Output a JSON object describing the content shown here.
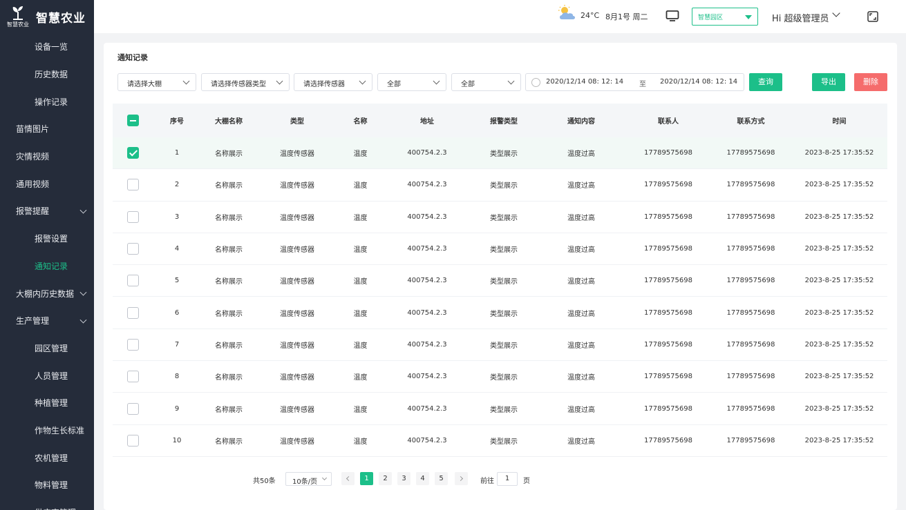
{
  "app": {
    "logo_small": "智慧农业",
    "title": "智慧农业"
  },
  "sidebar": {
    "items": [
      {
        "label": "设备一览",
        "level": "sub"
      },
      {
        "label": "历史数据",
        "level": "sub"
      },
      {
        "label": "操作记录",
        "level": "sub"
      },
      {
        "label": "苗情图片",
        "level": "top"
      },
      {
        "label": "灾情视频",
        "level": "top"
      },
      {
        "label": "通用视频",
        "level": "top"
      },
      {
        "label": "报警提醒",
        "level": "top",
        "expandable": true
      },
      {
        "label": "报警设置",
        "level": "sub"
      },
      {
        "label": "通知记录",
        "level": "sub",
        "active": true
      },
      {
        "label": "大棚内历史数据",
        "level": "top",
        "expandable": true
      },
      {
        "label": "生产管理",
        "level": "top",
        "expandable": true
      },
      {
        "label": "园区管理",
        "level": "sub"
      },
      {
        "label": "人员管理",
        "level": "sub"
      },
      {
        "label": "种植管理",
        "level": "sub"
      },
      {
        "label": "作物生长标准",
        "level": "sub"
      },
      {
        "label": "农机管理",
        "level": "sub"
      },
      {
        "label": "物料管理",
        "level": "sub"
      },
      {
        "label": "供应商管理",
        "level": "sub"
      }
    ]
  },
  "header": {
    "temperature": "24°C",
    "date": "8月1号 周二",
    "park_select": "智慧园区",
    "greeting": "Hi 超级管理员"
  },
  "page": {
    "title": "通知记录"
  },
  "filters": {
    "greenhouse": "请选择大棚",
    "sensor_type": "请选择传感器类型",
    "sensor": "请选择传感器",
    "status1": "全部",
    "status2": "全部",
    "date_start": "2020/12/14  08: 12: 14",
    "date_sep": "至",
    "date_end": "2020/12/14  08: 12: 14",
    "query_button": "查询",
    "export_button": "导出",
    "delete_button": "删除"
  },
  "table": {
    "headers": [
      "序号",
      "大棚名称",
      "类型",
      "名称",
      "地址",
      "报警类型",
      "通知内容",
      "联系人",
      "联系方式",
      "时间"
    ],
    "rows": [
      {
        "checked": true,
        "cells": [
          "1",
          "名称展示",
          "温度传感器",
          "温度",
          "400754.2.3",
          "类型展示",
          "温度过高",
          "17789575698",
          "17789575698",
          "2023-8-25  17:35:52"
        ]
      },
      {
        "checked": false,
        "cells": [
          "2",
          "名称展示",
          "温度传感器",
          "温度",
          "400754.2.3",
          "类型展示",
          "温度过高",
          "17789575698",
          "17789575698",
          "2023-8-25  17:35:52"
        ]
      },
      {
        "checked": false,
        "cells": [
          "3",
          "名称展示",
          "温度传感器",
          "温度",
          "400754.2.3",
          "类型展示",
          "温度过高",
          "17789575698",
          "17789575698",
          "2023-8-25  17:35:52"
        ]
      },
      {
        "checked": false,
        "cells": [
          "4",
          "名称展示",
          "温度传感器",
          "温度",
          "400754.2.3",
          "类型展示",
          "温度过高",
          "17789575698",
          "17789575698",
          "2023-8-25  17:35:52"
        ]
      },
      {
        "checked": false,
        "cells": [
          "5",
          "名称展示",
          "温度传感器",
          "温度",
          "400754.2.3",
          "类型展示",
          "温度过高",
          "17789575698",
          "17789575698",
          "2023-8-25  17:35:52"
        ]
      },
      {
        "checked": false,
        "cells": [
          "6",
          "名称展示",
          "温度传感器",
          "温度",
          "400754.2.3",
          "类型展示",
          "温度过高",
          "17789575698",
          "17789575698",
          "2023-8-25  17:35:52"
        ]
      },
      {
        "checked": false,
        "cells": [
          "7",
          "名称展示",
          "温度传感器",
          "温度",
          "400754.2.3",
          "类型展示",
          "温度过高",
          "17789575698",
          "17789575698",
          "2023-8-25  17:35:52"
        ]
      },
      {
        "checked": false,
        "cells": [
          "8",
          "名称展示",
          "温度传感器",
          "温度",
          "400754.2.3",
          "类型展示",
          "温度过高",
          "17789575698",
          "17789575698",
          "2023-8-25  17:35:52"
        ]
      },
      {
        "checked": false,
        "cells": [
          "9",
          "名称展示",
          "温度传感器",
          "温度",
          "400754.2.3",
          "类型展示",
          "温度过高",
          "17789575698",
          "17789575698",
          "2023-8-25  17:35:52"
        ]
      },
      {
        "checked": false,
        "cells": [
          "10",
          "名称展示",
          "温度传感器",
          "温度",
          "400754.2.3",
          "类型展示",
          "温度过高",
          "17789575698",
          "17789575698",
          "2023-8-25  17:35:52"
        ]
      }
    ]
  },
  "pagination": {
    "total": "共50条",
    "page_size": "10条/页",
    "pages": [
      "1",
      "2",
      "3",
      "4",
      "5"
    ],
    "current": "1",
    "goto_label": "前往",
    "goto_value": "1",
    "page_suffix": "页"
  },
  "colors": {
    "accent": "#1cbf89",
    "danger": "#f56c6c",
    "sidebar_bg": "#252c3a"
  }
}
